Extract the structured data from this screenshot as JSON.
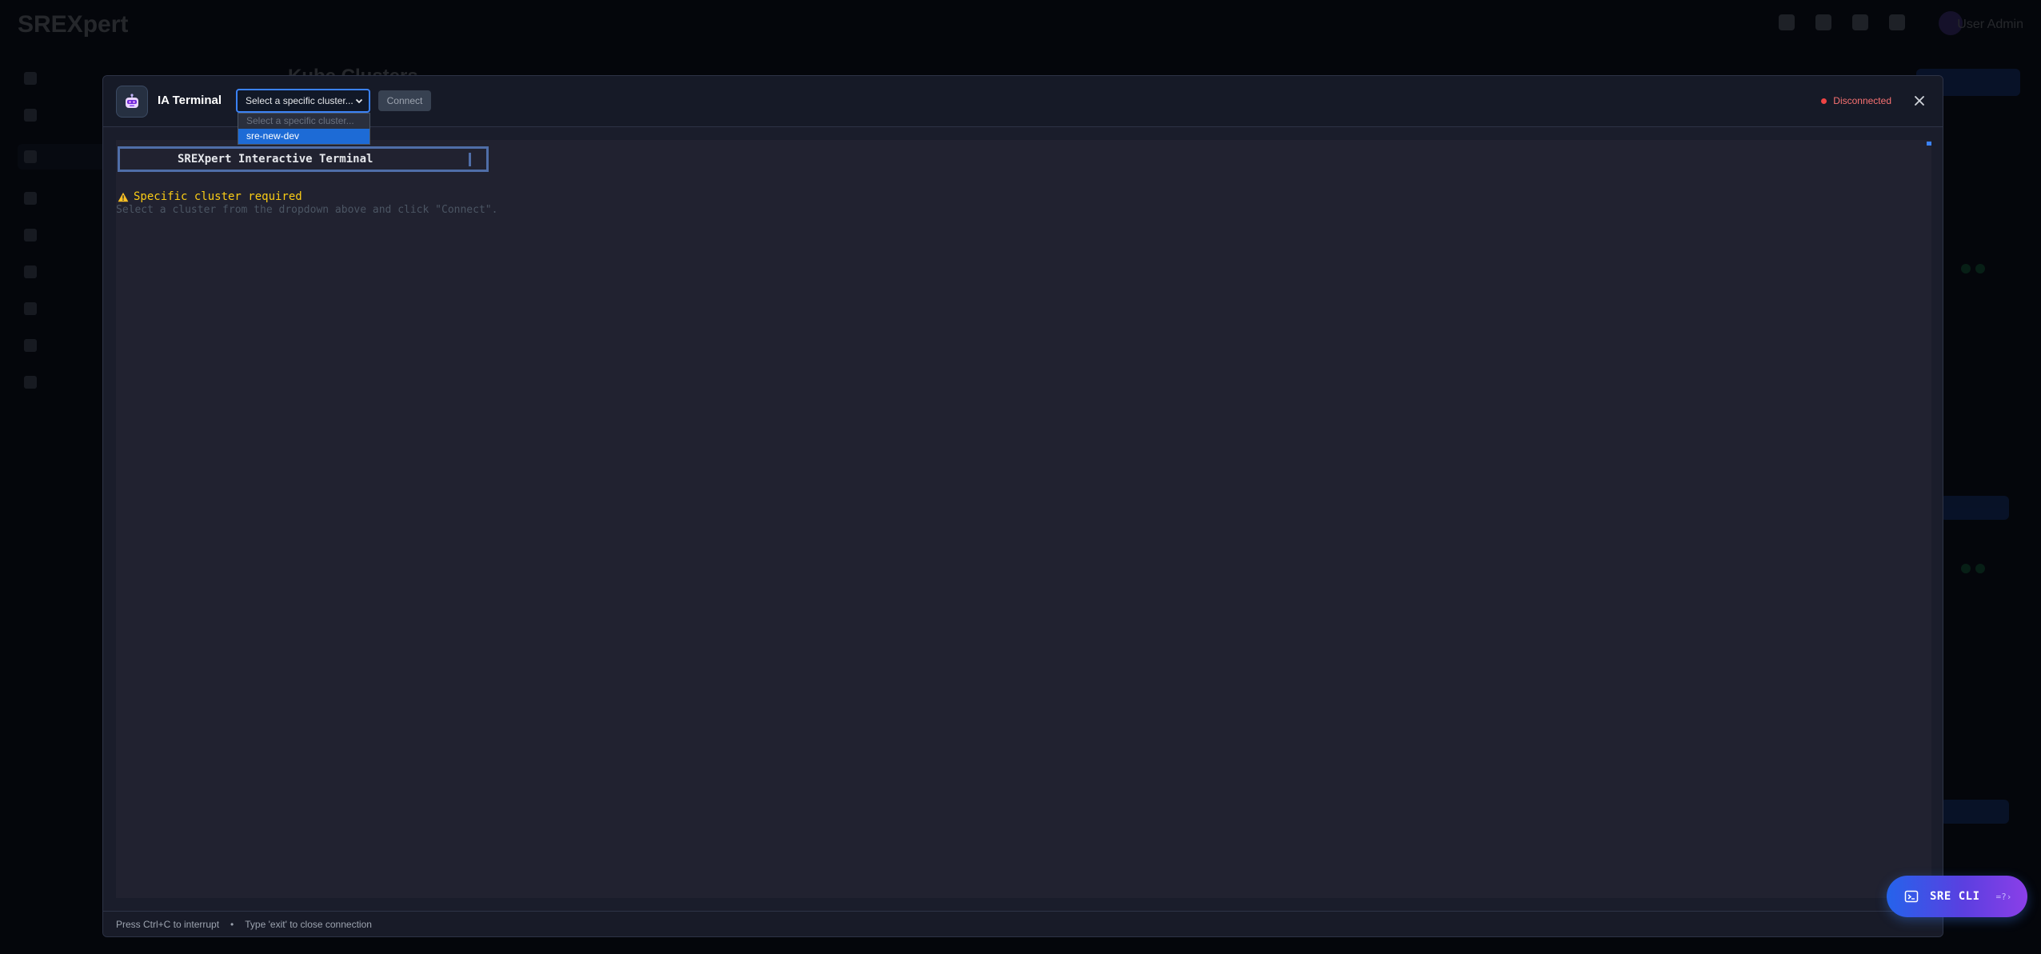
{
  "background": {
    "logo": "SREXpert",
    "user_name": "User Admin",
    "page_title": "Kube Clusters"
  },
  "terminal_modal": {
    "title": "IA Terminal",
    "cluster_select": {
      "value": "Select a specific cluster...",
      "options": [
        {
          "label": "Select a specific cluster...",
          "placeholder": true
        },
        {
          "label": "sre-new-dev",
          "highlighted": true
        }
      ]
    },
    "connect_label": "Connect",
    "status_label": "Disconnected",
    "terminal": {
      "banner": "SREXpert Interactive Terminal",
      "warning": "Specific cluster required",
      "hint": "Select a cluster from the dropdown above and click \"Connect\"."
    },
    "footer": {
      "interrupt_hint": "Press Ctrl+C to interrupt",
      "separator": "•",
      "exit_hint": "Type 'exit' to close connection"
    }
  },
  "sre_cli_button": {
    "label": "SRE CLI",
    "arrow": "=?›"
  },
  "colors": {
    "accent": "#3b82f6",
    "status_error": "#ef4444",
    "warning": "#facc15",
    "terminal_bg": "#212230"
  }
}
